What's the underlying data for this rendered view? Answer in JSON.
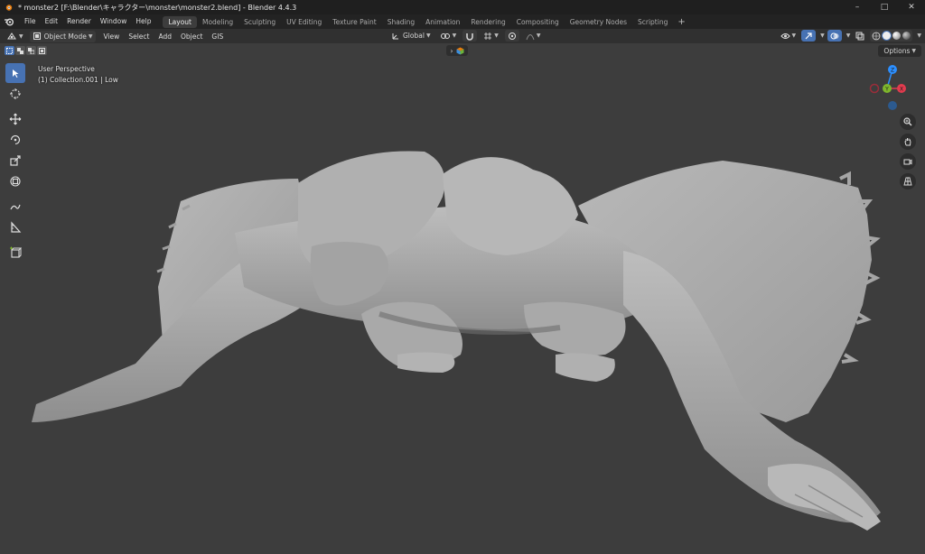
{
  "window": {
    "title": "* monster2 [F:\\Blender\\キャラクター\\monster\\monster2.blend] - Blender 4.4.3",
    "controls": [
      "minimize-icon",
      "maximize-icon",
      "close-icon"
    ]
  },
  "topbar": {
    "menus": [
      "File",
      "Edit",
      "Render",
      "Window",
      "Help"
    ],
    "workspaces": [
      "Layout",
      "Modeling",
      "Sculpting",
      "UV Editing",
      "Texture Paint",
      "Shading",
      "Animation",
      "Rendering",
      "Compositing",
      "Geometry Nodes",
      "Scripting"
    ],
    "active_workspace": "Layout",
    "add_label": "+"
  },
  "viewport_header": {
    "mode": "Object Mode",
    "menus": [
      "View",
      "Select",
      "Add",
      "Object",
      "GIS"
    ],
    "orientation": "Global"
  },
  "viewport": {
    "view_name": "User Perspective",
    "collection_info": "(1) Collection.001 | Low",
    "options_label": "Options",
    "background": "#3d3d3d"
  },
  "toolbar": {
    "tools": [
      "select-box-icon",
      "cursor-icon",
      "move-icon",
      "rotate-icon",
      "scale-icon",
      "transform-icon",
      "annotate-icon",
      "measure-icon",
      "add-cube-icon"
    ]
  },
  "gizmo": {
    "z_label": "Z",
    "y_label": "Y",
    "x_label": "X",
    "colors": {
      "x": "#e23b4e",
      "y": "#7fb62c",
      "z": "#2c8fff"
    }
  },
  "colors": {
    "accent": "#4772b3",
    "header": "#303030",
    "title_bg": "#1f1f1f"
  }
}
